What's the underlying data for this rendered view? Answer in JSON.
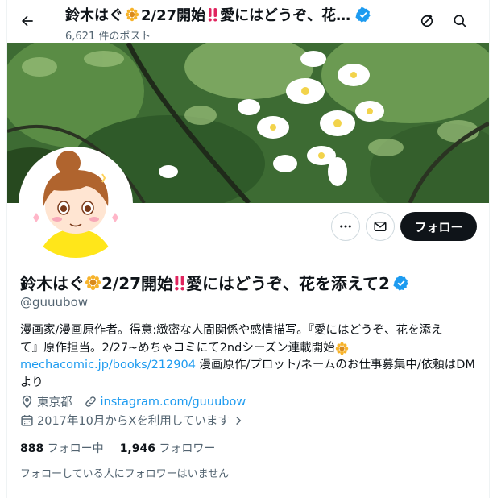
{
  "header": {
    "display_name": "鈴木はぐ",
    "name_rest": "2/27開始",
    "name_tail": "愛にはどうぞ、花…",
    "post_count": "6,621 件のポスト"
  },
  "profile": {
    "name_part1": "鈴木はぐ",
    "name_part2": "2/27開始",
    "name_part3": "愛にはどうぞ、花を添えて2",
    "handle": "@guuubow",
    "follow_label": "フォロー",
    "bio_line1": "漫画家/漫画原作者。得意:緻密な人間関係や感情描写。『愛にはどうぞ、花を添え",
    "bio_line2": "て』原作担当。2/27~めちゃコミにて2ndシーズン連載開始",
    "bio_link": "mechacomic.jp/books/212904",
    "bio_line3_rest": " 漫画原作/プロット/ネームのお仕事募集中/依頼はDM",
    "bio_line4": "より",
    "location": "東京都",
    "website": "instagram.com/guuubow",
    "joined": "2017年10月からXを利用しています",
    "following_count": "888",
    "following_label": "フォロー中",
    "followers_count": "1,946",
    "followers_label": "フォロワー",
    "mutual_text": "フォローしている人にフォロワーはいません"
  },
  "colors": {
    "accent": "#1d9bf0",
    "text": "#0f1419",
    "muted": "#536471",
    "verified": "#1d9bf0",
    "double_exclamation": "#e0245e"
  },
  "icons": [
    "back-arrow-icon",
    "sunflower-emoji",
    "double-exclamation-emoji",
    "verified-badge-icon",
    "shield-slash-icon",
    "search-icon",
    "more-icon",
    "message-icon",
    "location-icon",
    "link-icon",
    "calendar-icon",
    "chevron-right-icon"
  ]
}
